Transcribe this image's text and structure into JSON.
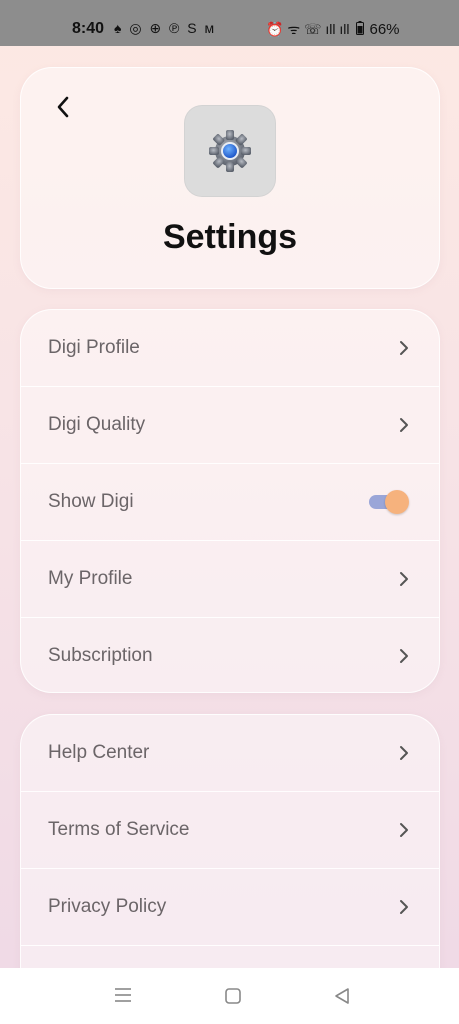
{
  "status_bar": {
    "time": "8:40",
    "app_icons": "♠ ◎ ⊕ ℗ S ᴍ",
    "right_icons": "⏰ ᯤ ☏ ıll ıll",
    "battery": "66%"
  },
  "header": {
    "back_icon": "chevron-left-icon",
    "app_icon": "gear-icon",
    "title": "Settings"
  },
  "menu_group_1": {
    "items": [
      {
        "label": "Digi Profile",
        "control": "chevron"
      },
      {
        "label": "Digi Quality",
        "control": "chevron"
      },
      {
        "label": "Show Digi",
        "control": "toggle",
        "toggle_on": true
      },
      {
        "label": "My Profile",
        "control": "chevron"
      },
      {
        "label": "Subscription",
        "control": "chevron"
      }
    ]
  },
  "menu_group_2": {
    "items": [
      {
        "label": "Help Center",
        "control": "chevron"
      },
      {
        "label": "Terms of Service",
        "control": "chevron"
      },
      {
        "label": "Privacy Policy",
        "control": "chevron"
      }
    ]
  },
  "colors": {
    "toggle_track": "#9aa6d8",
    "toggle_knob": "#f6b27d",
    "label_text": "#6b6568"
  },
  "nav_bar": {
    "buttons": [
      "menu-icon",
      "home-icon",
      "back-triangle-icon"
    ]
  }
}
